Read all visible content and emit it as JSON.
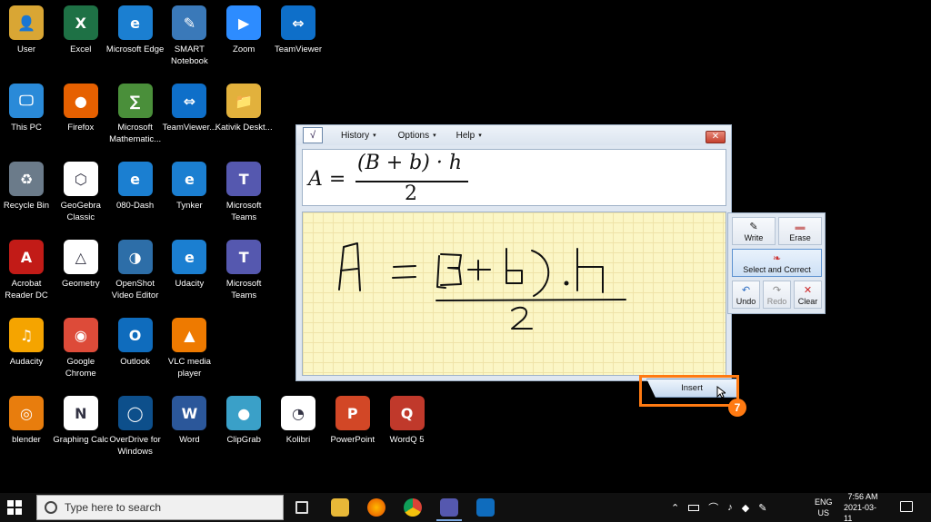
{
  "desktop": {
    "icons": [
      {
        "label": "User",
        "glyph": "👤",
        "color": "#d9a634"
      },
      {
        "label": "Excel",
        "glyph": "X",
        "color": "#1e7145"
      },
      {
        "label": "Microsoft Edge",
        "glyph": "e",
        "color": "#1b7fd1"
      },
      {
        "label": "SMART Notebook",
        "glyph": "✎",
        "color": "#3a79b9"
      },
      {
        "label": "Zoom",
        "glyph": "▶",
        "color": "#2d8cff"
      },
      {
        "label": "TeamViewer",
        "glyph": "⇔",
        "color": "#0e6fc9"
      },
      {
        "label": "This PC",
        "glyph": "🖵",
        "color": "#2a8ad8"
      },
      {
        "label": "Firefox",
        "glyph": "●",
        "color": "#e66000"
      },
      {
        "label": "Microsoft Mathematic...",
        "glyph": "∑",
        "color": "#4a8f3a"
      },
      {
        "label": "TeamViewer...",
        "glyph": "⇔",
        "color": "#0e6fc9"
      },
      {
        "label": "Kativik Deskt...",
        "glyph": "📁",
        "color": "#e2b13c"
      },
      {
        "label": "Recycle Bin",
        "glyph": "♻",
        "color": "#6b7b8a"
      },
      {
        "label": "GeoGebra Classic",
        "glyph": "⬡",
        "color": "#ffffff"
      },
      {
        "label": "080-Dash",
        "glyph": "e",
        "color": "#1b7fd1"
      },
      {
        "label": "Tynker",
        "glyph": "e",
        "color": "#1b7fd1"
      },
      {
        "label": "Microsoft Teams",
        "glyph": "T",
        "color": "#5558af"
      },
      {
        "label": "Acrobat Reader DC",
        "glyph": "A",
        "color": "#c21b17"
      },
      {
        "label": "Geometry",
        "glyph": "△",
        "color": "#ffffff"
      },
      {
        "label": "OpenShot Video Editor",
        "glyph": "◑",
        "color": "#2d6ea8"
      },
      {
        "label": "Udacity",
        "glyph": "e",
        "color": "#1b7fd1"
      },
      {
        "label": "Microsoft Teams",
        "glyph": "T",
        "color": "#5558af"
      },
      {
        "label": "Audacity",
        "glyph": "♫",
        "color": "#f5a400"
      },
      {
        "label": "Google Chrome",
        "glyph": "◉",
        "color": "#dd4b39"
      },
      {
        "label": "Outlook",
        "glyph": "O",
        "color": "#0f6cbd"
      },
      {
        "label": "VLC media player",
        "glyph": "▲",
        "color": "#ee7a00"
      },
      {
        "label": "blender",
        "glyph": "◎",
        "color": "#e87d0d"
      },
      {
        "label": "Graphing Calc",
        "glyph": "N",
        "color": "#ffffff"
      },
      {
        "label": "OverDrive for Windows",
        "glyph": "◯",
        "color": "#0d4f8b"
      },
      {
        "label": "Word",
        "glyph": "W",
        "color": "#2b579a"
      },
      {
        "label": "ClipGrab",
        "glyph": "●",
        "color": "#3aa0c8"
      },
      {
        "label": "Kolibri",
        "glyph": "◔",
        "color": "#ffffff"
      },
      {
        "label": "PowerPoint",
        "glyph": "P",
        "color": "#d24726"
      },
      {
        "label": "WordQ 5",
        "glyph": "Q",
        "color": "#c0392b"
      }
    ]
  },
  "mip": {
    "menus": [
      {
        "label": "History",
        "caret": "▾"
      },
      {
        "label": "Options",
        "caret": "▾"
      },
      {
        "label": "Help",
        "caret": "▾"
      }
    ],
    "logo": "√",
    "close": "✕",
    "preview": {
      "lhs": "A =",
      "numerator": "(B + b) · h",
      "denominator": "2"
    },
    "tools": {
      "write": {
        "label": "Write",
        "icon": "✎"
      },
      "erase": {
        "label": "Erase",
        "icon": "▬"
      },
      "select": {
        "label": "Select and Correct",
        "icon": "❧"
      },
      "undo": {
        "label": "Undo",
        "icon": "↶"
      },
      "redo": {
        "label": "Redo",
        "icon": "↷"
      },
      "clear": {
        "label": "Clear",
        "icon": "✕"
      }
    },
    "insert": "Insert",
    "step": "7"
  },
  "taskbar": {
    "search_placeholder": "Type here to search",
    "lang1": "ENG",
    "lang2": "US",
    "time": "7:56 AM",
    "date": "2021-03-11"
  }
}
